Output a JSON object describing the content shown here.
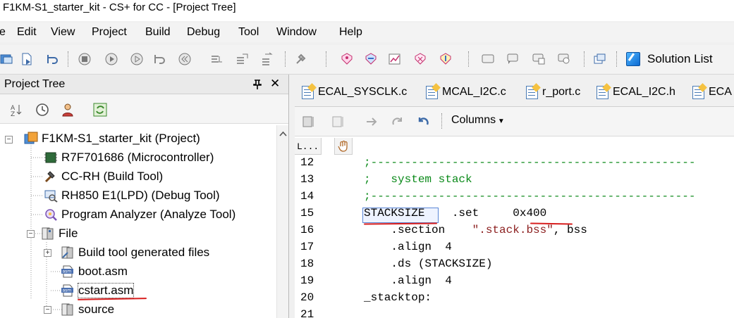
{
  "window": {
    "title": "F1KM-S1_starter_kit - CS+ for CC - [Project Tree]"
  },
  "menu": [
    "e",
    "Edit",
    "View",
    "Project",
    "Build",
    "Debug",
    "Tool",
    "Window",
    "Help"
  ],
  "toolbar": {
    "solution_list": "Solution List"
  },
  "project_tree": {
    "title": "Project Tree",
    "pin": "ᵖ",
    "close": "✕",
    "items": [
      {
        "label": "F1KM-S1_starter_kit (Project)",
        "icon": "project-icon"
      },
      {
        "label": "R7F701686 (Microcontroller)",
        "icon": "chip-icon"
      },
      {
        "label": "CC-RH (Build Tool)",
        "icon": "hammer-icon"
      },
      {
        "label": "RH850 E1(LPD) (Debug Tool)",
        "icon": "debug-icon"
      },
      {
        "label": "Program Analyzer (Analyze Tool)",
        "icon": "analyzer-icon"
      },
      {
        "label": "File",
        "icon": "folder-icon"
      },
      {
        "label": "Build tool generated files",
        "icon": "folder-icon"
      },
      {
        "label": "boot.asm",
        "icon": "asm-file-icon"
      },
      {
        "label": "cstart.asm",
        "icon": "asm-file-icon"
      },
      {
        "label": "source",
        "icon": "folder-icon"
      }
    ]
  },
  "editor": {
    "tabs": [
      "ECAL_SYSCLK.c",
      "MCAL_I2C.c",
      "r_port.c",
      "ECAL_I2C.h",
      "ECA"
    ],
    "columns_label": "Columns",
    "line_header": "L...",
    "lines": [
      {
        "no": "12",
        "segments": [
          {
            "t": ";------------------------------------------------",
            "c": "cmt"
          }
        ]
      },
      {
        "no": "13",
        "segments": [
          {
            "t": ";   system stack",
            "c": "cmt"
          }
        ]
      },
      {
        "no": "14",
        "segments": [
          {
            "t": ";------------------------------------------------",
            "c": "cmt"
          }
        ]
      },
      {
        "no": "15",
        "segments": [
          {
            "t": "STACKSIZE",
            "c": ""
          },
          {
            "t": "    .set     ",
            "c": ""
          },
          {
            "t": "0x400",
            "c": ""
          }
        ]
      },
      {
        "no": "16",
        "segments": [
          {
            "t": "    .section    ",
            "c": ""
          },
          {
            "t": "\".stack.bss\"",
            "c": "str"
          },
          {
            "t": ", bss",
            "c": ""
          }
        ]
      },
      {
        "no": "17",
        "segments": [
          {
            "t": "    .align  4",
            "c": ""
          }
        ]
      },
      {
        "no": "18",
        "segments": [
          {
            "t": "    .ds (STACKSIZE)",
            "c": ""
          }
        ]
      },
      {
        "no": "19",
        "segments": [
          {
            "t": "    .align  4",
            "c": ""
          }
        ]
      },
      {
        "no": "20",
        "segments": [
          {
            "t": "_stacktop:",
            "c": ""
          }
        ]
      },
      {
        "no": "21",
        "segments": [
          {
            "t": "",
            "c": ""
          }
        ]
      }
    ]
  },
  "colors": {
    "annotation": "#d81e1e",
    "comment": "#0b8a1a",
    "string": "#8b1e1e"
  }
}
